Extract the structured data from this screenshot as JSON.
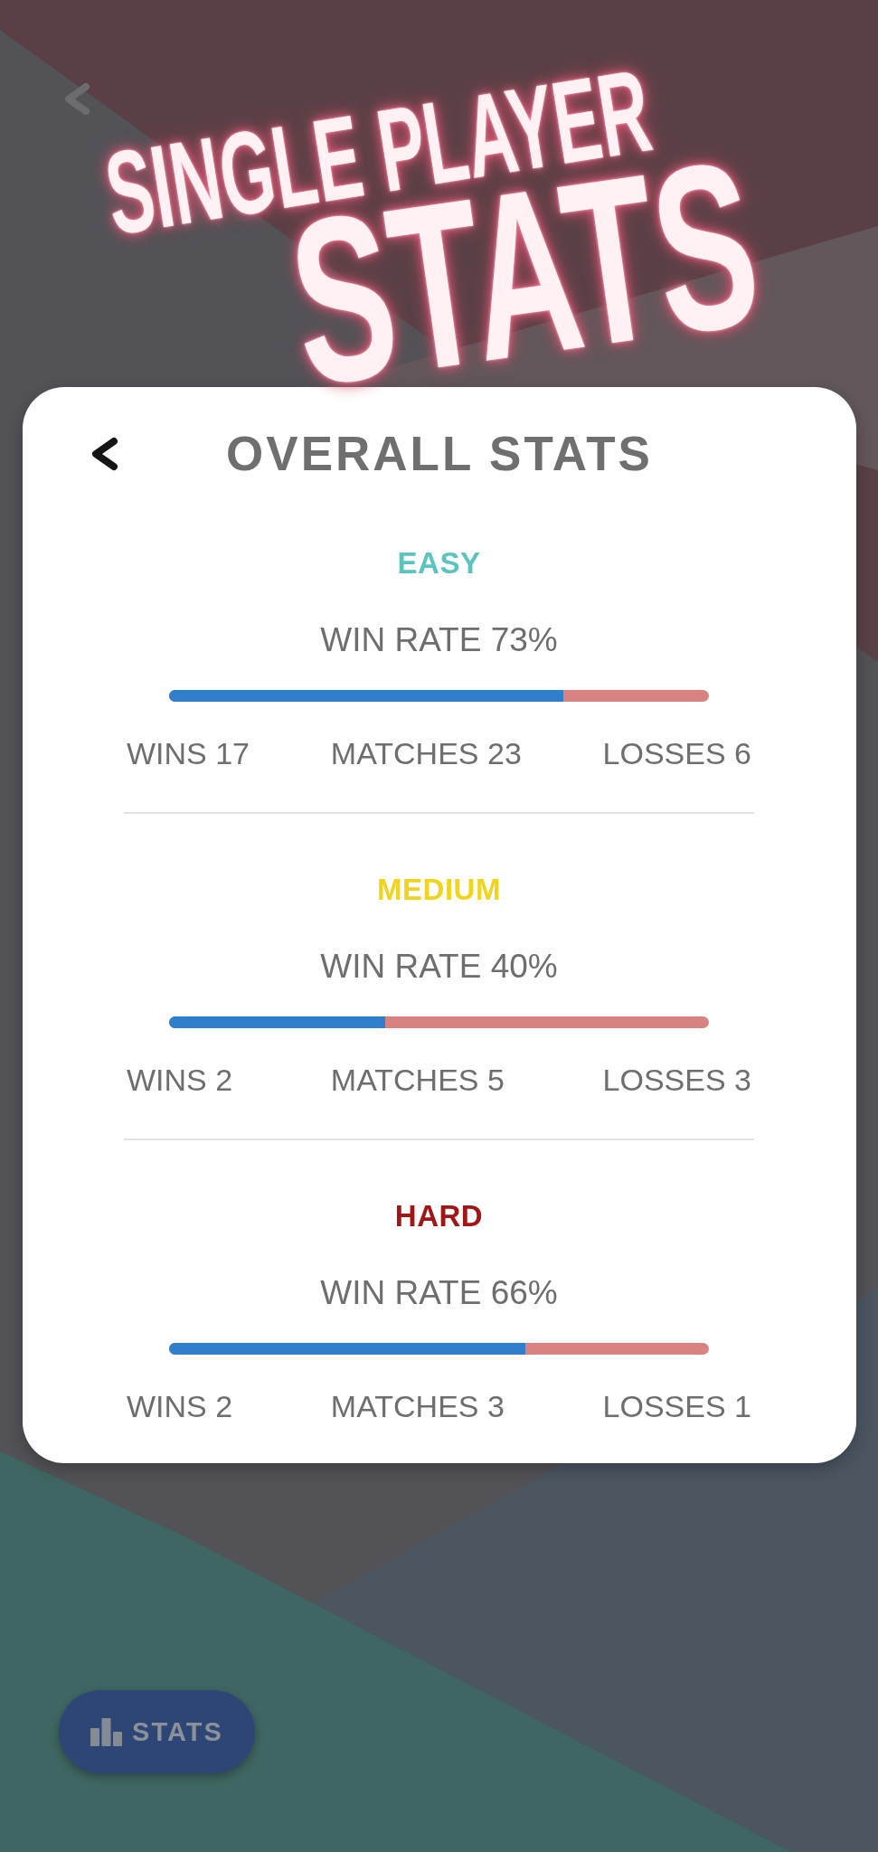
{
  "promo_title": {
    "top_line": "SINGLE PLAYER",
    "bottom_line": "STATS"
  },
  "card": {
    "title": "OVERALL STATS",
    "difficulties": [
      {
        "label": "EASY",
        "color": "#5cc4be",
        "win_rate": "WIN RATE 73%",
        "level": 0.73,
        "wins": "WINS 17",
        "matches": "MATCHES 23",
        "losses": "LOSSES 6"
      },
      {
        "label": "MEDIUM",
        "color": "#f0d41e",
        "win_rate": "WIN RATE 40%",
        "level": 0.4,
        "wins": "WINS 2",
        "matches": "MATCHES 5",
        "losses": "LOSSES 3"
      },
      {
        "label": "HARD",
        "color": "#a11616",
        "win_rate": "WIN RATE 66%",
        "level": 0.66,
        "wins": "WINS 2",
        "matches": "MATCHES 3",
        "losses": "LOSSES 1"
      }
    ]
  },
  "stats_button": {
    "label": "STATS"
  }
}
